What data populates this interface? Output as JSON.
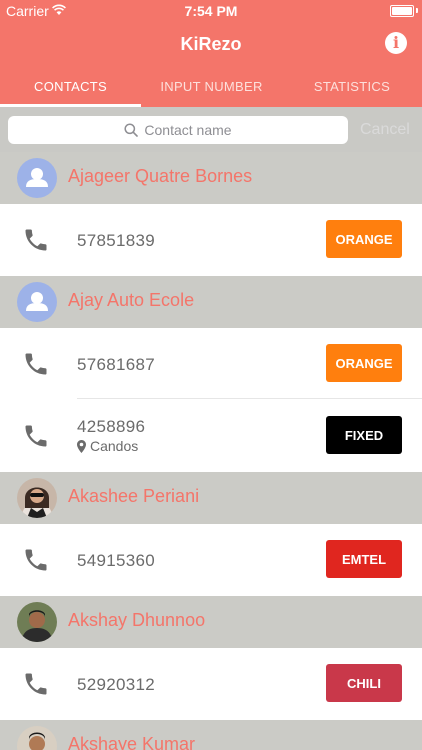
{
  "status_bar": {
    "carrier": "Carrier",
    "time": "7:54 PM"
  },
  "header": {
    "title": "KiRezo",
    "info_icon": "info-icon"
  },
  "tabs": [
    {
      "label": "CONTACTS",
      "active": true
    },
    {
      "label": "INPUT NUMBER",
      "active": false
    },
    {
      "label": "STATISTICS",
      "active": false
    }
  ],
  "search": {
    "placeholder": "Contact name",
    "cancel_label": "Cancel"
  },
  "colors": {
    "brand": "#f4756a",
    "orange": "#ff7f0e",
    "fixed": "#000000",
    "emtel": "#e0261f",
    "chili": "#c9384a"
  },
  "contacts": [
    {
      "name": "Ajageer Quatre Bornes",
      "avatar": "placeholder",
      "numbers": [
        {
          "number": "57851839",
          "operator": "ORANGE"
        }
      ]
    },
    {
      "name": "Ajay Auto Ecole",
      "avatar": "placeholder",
      "numbers": [
        {
          "number": "57681687",
          "operator": "ORANGE"
        },
        {
          "number": "4258896",
          "location": "Candos",
          "operator": "FIXED"
        }
      ]
    },
    {
      "name": "Akashee Periani",
      "avatar": "photo",
      "numbers": [
        {
          "number": "54915360",
          "operator": "EMTEL"
        }
      ]
    },
    {
      "name": "Akshay Dhunnoo",
      "avatar": "photo",
      "numbers": [
        {
          "number": "52920312",
          "operator": "CHILI"
        }
      ]
    },
    {
      "name": "Akshaye Kumar",
      "avatar": "photo",
      "numbers": []
    }
  ]
}
